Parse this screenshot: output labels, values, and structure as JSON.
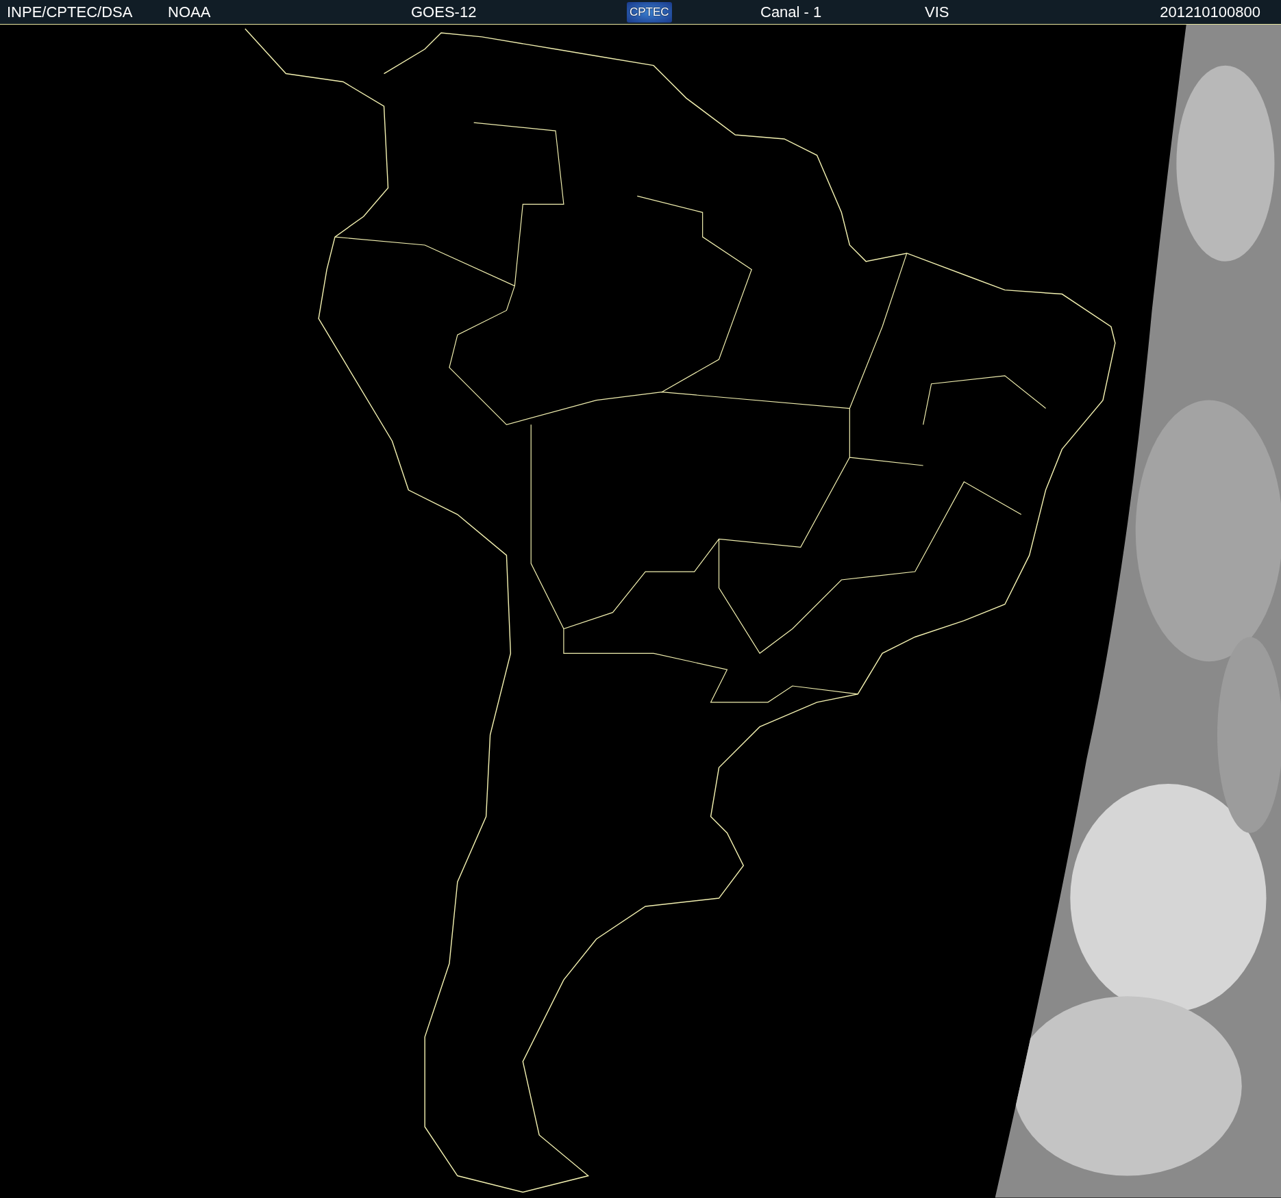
{
  "header": {
    "items": [
      {
        "kind": "text",
        "text": "INPE/CPTEC/DSA"
      },
      {
        "kind": "text",
        "text": "NOAA"
      },
      {
        "kind": "text",
        "text": "GOES-12"
      },
      {
        "kind": "logo",
        "text": "CPTEC"
      },
      {
        "kind": "text",
        "text": "Canal - 1"
      },
      {
        "kind": "text",
        "text": "VIS"
      },
      {
        "kind": "text",
        "text": "201210100800"
      }
    ]
  }
}
